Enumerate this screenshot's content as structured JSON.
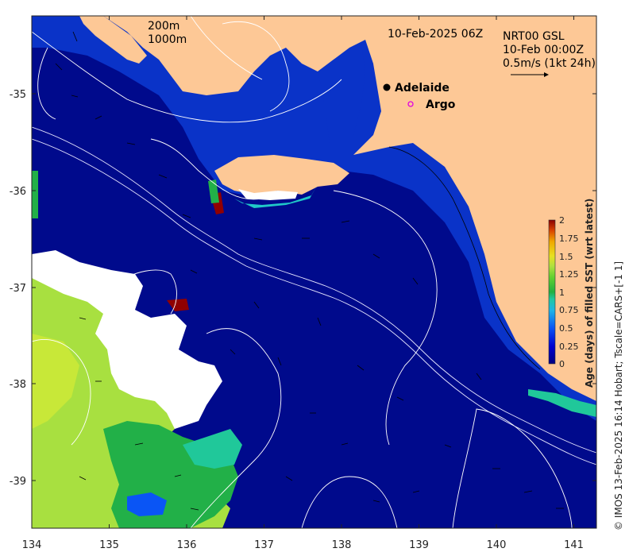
{
  "map": {
    "date_label": "10-Feb-2025 06Z",
    "product_label": "NRT00 GSL",
    "vector_time": "10-Feb 00:00Z",
    "scale_label": "0.5m/s (1kt 24h)",
    "isobath_labels": [
      "200m",
      "1000m"
    ],
    "x_ticks": [
      "134",
      "135",
      "136",
      "137",
      "138",
      "139",
      "140",
      "141"
    ],
    "y_ticks": [
      "-35",
      "-36",
      "-37",
      "-38",
      "-39"
    ],
    "places": [
      {
        "name": "Adelaide",
        "lon": 138.6,
        "lat": -34.93,
        "marker": "filled-dot"
      },
      {
        "name": "Argo",
        "lon": 138.87,
        "lat": -35.11,
        "marker": "open-circle-magenta"
      }
    ],
    "colorbar": {
      "title": "Age (days) of filled SST (wrt latest)",
      "ticks": [
        "2",
        "1.75",
        "1.5",
        "1.25",
        "1",
        "0.75",
        "0.5",
        "0.25",
        "0"
      ],
      "range": [
        0,
        2
      ],
      "colors": [
        "#000080",
        "#0000c8",
        "#0a4ff0",
        "#1ea0e8",
        "#20c8b0",
        "#22b04a",
        "#60d030",
        "#a8e040",
        "#e0e020",
        "#f0b000",
        "#e05000",
        "#900000"
      ]
    },
    "credit": "© IMOS 13-Feb-2025 16:14 Hobart; Tscale=CARS+[-1 1]",
    "colors": {
      "land": "#fdc896",
      "ocean": "#000a8c",
      "shelf": "#0a33c8",
      "data_gap": "#ffffff"
    }
  }
}
